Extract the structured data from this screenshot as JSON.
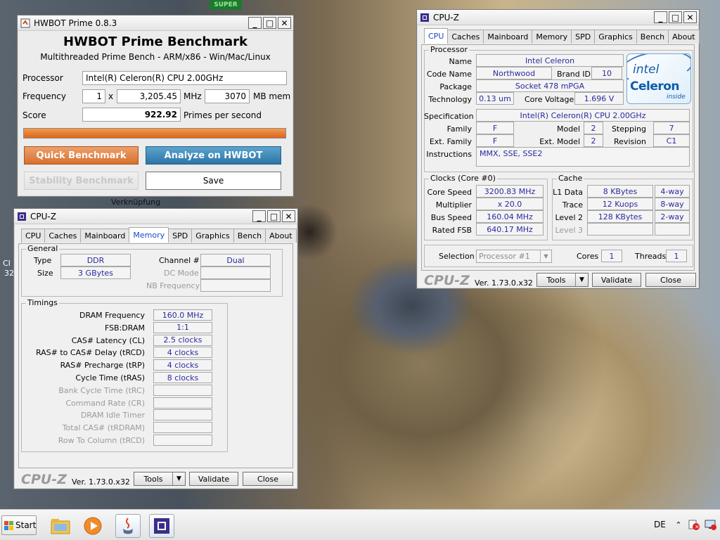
{
  "desktop": {
    "label_verknupfung": "Verknüpfung",
    "label_super": "SUPER",
    "left_edge_1": "CI",
    "left_edge_2": "32"
  },
  "hwbot": {
    "title": "HWBOT Prime 0.8.3",
    "heading": "HWBOT Prime Benchmark",
    "subheading": "Multithreaded Prime Bench - ARM/x86 - Win/Mac/Linux",
    "processor_label": "Processor",
    "processor_value": "Intel(R) Celeron(R) CPU 2.00GHz",
    "frequency_label": "Frequency",
    "frequency_multi": "1",
    "frequency_x": "x",
    "frequency_value": "3,205.45",
    "frequency_unit": "MHz",
    "mem_value": "3070",
    "mem_unit": "MB mem",
    "score_label": "Score",
    "score_value": "922.92",
    "score_unit": "Primes per second",
    "progress_fraction": 1.0,
    "quick_btn": "Quick Benchmark",
    "analyze_btn": "Analyze on HWBOT",
    "stability_btn": "Stability Benchmark",
    "save_btn": "Save"
  },
  "cpuz_mem": {
    "title": "CPU-Z",
    "tabs": [
      "CPU",
      "Caches",
      "Mainboard",
      "Memory",
      "SPD",
      "Graphics",
      "Bench",
      "About"
    ],
    "active_tab": "Memory",
    "general_title": "General",
    "type_label": "Type",
    "type_value": "DDR",
    "size_label": "Size",
    "size_value": "3 GBytes",
    "channel_label": "Channel #",
    "channel_value": "Dual",
    "dcmode_label": "DC Mode",
    "dcmode_value": "",
    "nbfreq_label": "NB Frequency",
    "nbfreq_value": "",
    "timings_title": "Timings",
    "timings": [
      {
        "label": "DRAM Frequency",
        "value": "160.0 MHz",
        "enabled": true
      },
      {
        "label": "FSB:DRAM",
        "value": "1:1",
        "enabled": true
      },
      {
        "label": "CAS# Latency (CL)",
        "value": "2.5 clocks",
        "enabled": true
      },
      {
        "label": "RAS# to CAS# Delay (tRCD)",
        "value": "4 clocks",
        "enabled": true
      },
      {
        "label": "RAS# Precharge (tRP)",
        "value": "4 clocks",
        "enabled": true
      },
      {
        "label": "Cycle Time (tRAS)",
        "value": "8 clocks",
        "enabled": true
      },
      {
        "label": "Bank Cycle Time (tRC)",
        "value": "",
        "enabled": false
      },
      {
        "label": "Command Rate (CR)",
        "value": "",
        "enabled": false
      },
      {
        "label": "DRAM Idle Timer",
        "value": "",
        "enabled": false
      },
      {
        "label": "Total CAS# (tRDRAM)",
        "value": "",
        "enabled": false
      },
      {
        "label": "Row To Column (tRCD)",
        "value": "",
        "enabled": false
      }
    ],
    "brand": "CPU-Z",
    "version": "Ver. 1.73.0.x32",
    "tools_btn": "Tools",
    "validate_btn": "Validate",
    "close_btn": "Close"
  },
  "cpuz_cpu": {
    "title": "CPU-Z",
    "tabs": [
      "CPU",
      "Caches",
      "Mainboard",
      "Memory",
      "SPD",
      "Graphics",
      "Bench",
      "About"
    ],
    "active_tab": "CPU",
    "processor_title": "Processor",
    "name_label": "Name",
    "name_value": "Intel Celeron",
    "codename_label": "Code Name",
    "codename_value": "Northwood",
    "brandid_label": "Brand ID",
    "brandid_value": "10",
    "package_label": "Package",
    "package_value": "Socket 478 mPGA",
    "tech_label": "Technology",
    "tech_value": "0.13 um",
    "voltage_label": "Core Voltage",
    "voltage_value": "1.696 V",
    "spec_label": "Specification",
    "spec_value": "Intel(R) Celeron(R) CPU 2.00GHz",
    "family_label": "Family",
    "family_value": "F",
    "model_label": "Model",
    "model_value": "2",
    "stepping_label": "Stepping",
    "stepping_value": "7",
    "extfamily_label": "Ext. Family",
    "extfamily_value": "F",
    "extmodel_label": "Ext. Model",
    "extmodel_value": "2",
    "revision_label": "Revision",
    "revision_value": "C1",
    "instr_label": "Instructions",
    "instr_value": "MMX, SSE, SSE2",
    "logo_intel": "intel",
    "logo_celeron": "Celeron",
    "logo_inside": "inside",
    "clocks_title": "Clocks (Core #0)",
    "corespeed_label": "Core Speed",
    "corespeed_value": "3200.83 MHz",
    "multiplier_label": "Multiplier",
    "multiplier_value": "x 20.0",
    "busspeed_label": "Bus Speed",
    "busspeed_value": "160.04 MHz",
    "ratedfsb_label": "Rated FSB",
    "ratedfsb_value": "640.17 MHz",
    "cache_title": "Cache",
    "l1_label": "L1 Data",
    "l1_value": "8 KBytes",
    "l1_way": "4-way",
    "trace_label": "Trace",
    "trace_value": "12 Kuops",
    "trace_way": "8-way",
    "l2_label": "Level 2",
    "l2_value": "128 KBytes",
    "l2_way": "2-way",
    "l3_label": "Level 3",
    "l3_value": "",
    "l3_way": "",
    "selection_label": "Selection",
    "selection_value": "Processor #1",
    "cores_label": "Cores",
    "cores_value": "1",
    "threads_label": "Threads",
    "threads_value": "1",
    "brand": "CPU-Z",
    "version": "Ver. 1.73.0.x32",
    "tools_btn": "Tools",
    "validate_btn": "Validate",
    "close_btn": "Close"
  },
  "taskbar": {
    "start_label": "Start",
    "language": "DE"
  }
}
